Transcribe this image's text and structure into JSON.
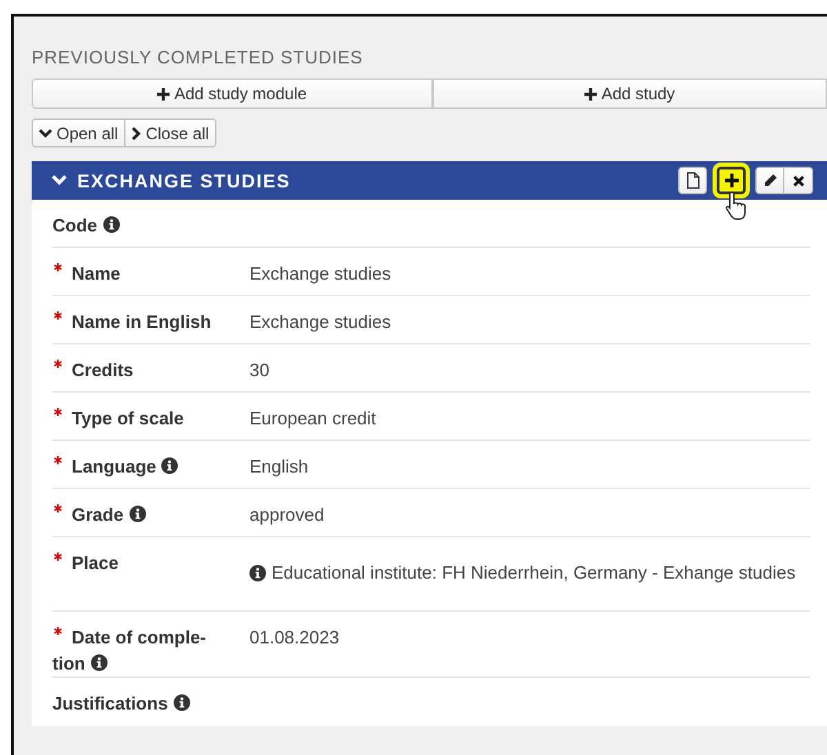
{
  "section_title": "PREVIOUSLY COMPLETED STUDIES",
  "add_buttons": [
    {
      "label": "Add study module"
    },
    {
      "label": "Add study"
    }
  ],
  "toggle_buttons": [
    {
      "label": "Open all",
      "kind": "open"
    },
    {
      "label": "Close all",
      "kind": "close"
    }
  ],
  "panel": {
    "title": "EXCHANGE STUDIES",
    "expanded": true,
    "actions": [
      {
        "kind": "new",
        "highlighted": false
      },
      {
        "kind": "add",
        "highlighted": true
      },
      {
        "kind": "edit",
        "highlighted": false
      },
      {
        "kind": "delete",
        "highlighted": false
      }
    ],
    "fields": [
      {
        "label": "Code",
        "required": false,
        "info": true
      },
      {
        "label": "Name",
        "required": true,
        "info": false,
        "value": "Exchange studies"
      },
      {
        "label": "Name in English",
        "required": true,
        "info": false,
        "value": "Exchange studies"
      },
      {
        "label": "Credits",
        "required": true,
        "info": false,
        "value": "30"
      },
      {
        "label": "Type of scale",
        "required": true,
        "info": false,
        "value": "European credit"
      },
      {
        "label": "Language",
        "required": true,
        "info": true,
        "value": "English"
      },
      {
        "label": "Grade",
        "required": true,
        "info": true,
        "value": "approved"
      },
      {
        "label": "Place",
        "required": true,
        "info": false,
        "value": "Educational institute: FH Niederrhein, Germany - Exhange studies",
        "value_info": true
      },
      {
        "label": "Date of comple-tion",
        "required": true,
        "info": true,
        "value": "01.08.2023"
      },
      {
        "label": "Justifications",
        "required": false,
        "info": true
      }
    ]
  }
}
